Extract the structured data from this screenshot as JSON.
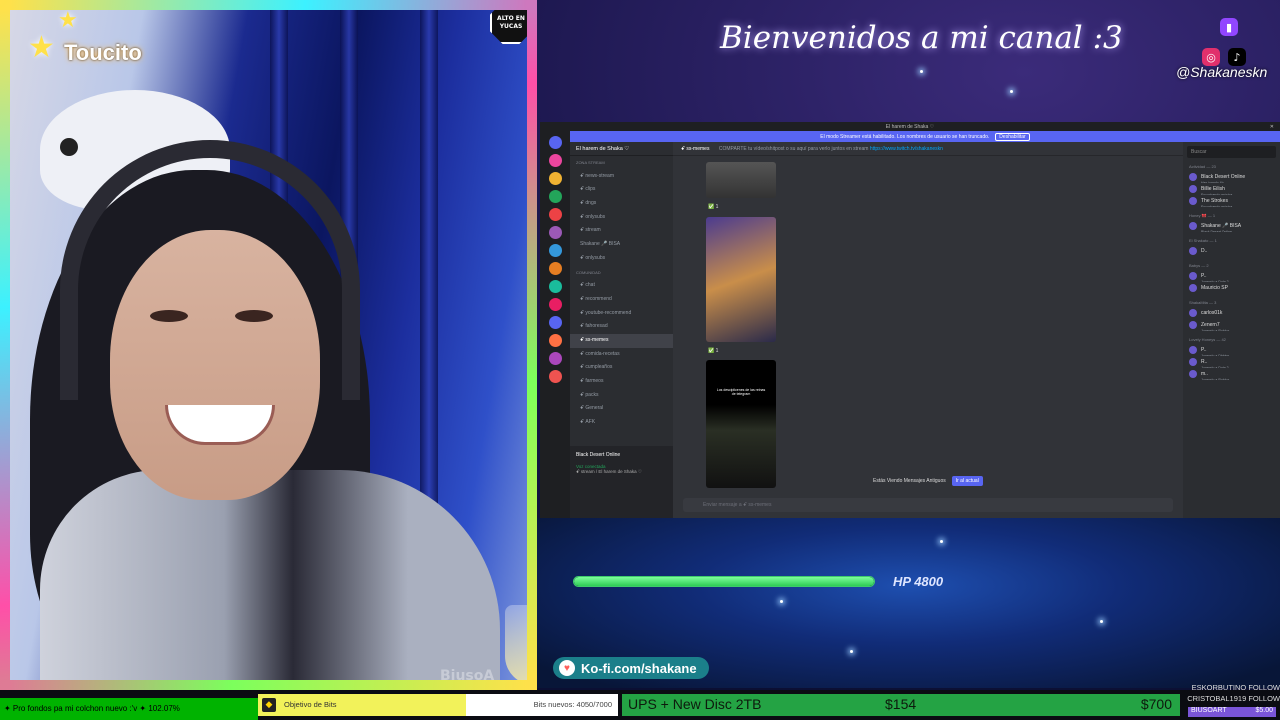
{
  "overlay": {
    "welcome_title": "Bienvenidos a mi canal :3",
    "social_handle": "@Shakaneskn",
    "social_icons": [
      "twitch-icon",
      "instagram-icon",
      "tiktok-icon"
    ],
    "webcam_sticker": "Toucito",
    "stop_sign": "ALTO EN YUCAS",
    "watermark": "BiusoA"
  },
  "discord": {
    "window_title": "El harem de Shaka ♡",
    "banner_text": "El modo Streamer está habilitado. Los nombres de usuario se han truncado.",
    "banner_button": "Deshabilitar",
    "server_name": "El harem de Shaka ♡",
    "channels": [
      {
        "label": "ZONA STREAM",
        "category": true
      },
      {
        "label": "ꗃ news-stream"
      },
      {
        "label": "ꗃ clips"
      },
      {
        "label": "ꗃ dngs"
      },
      {
        "label": "ꗃ onlysubs"
      },
      {
        "label": "ꗃ stream"
      },
      {
        "label": "Shakane 🎤 BISA"
      },
      {
        "label": "ꗃ onlysubs"
      },
      {
        "label": "COMUNIDAD",
        "category": true
      },
      {
        "label": "ꗃ chat"
      },
      {
        "label": "ꗃ recommend"
      },
      {
        "label": "ꗃ youtube-recommend"
      },
      {
        "label": "ꗃ fahoresad"
      },
      {
        "label": "ꗃ ss-memes",
        "active": true
      },
      {
        "label": "ꗃ comida-recetas"
      },
      {
        "label": "ꗃ cumpleaños"
      },
      {
        "label": "ꗃ farmeos"
      },
      {
        "label": "ꗃ packs"
      },
      {
        "label": "ꗃ General"
      },
      {
        "label": "ꗃ AFK"
      }
    ],
    "voice_panel": {
      "game": "Black Desert Online",
      "status": "Voz conectada",
      "location": "ꗃ stream / El harem de Shaka ♡"
    },
    "channel_header": "ꗃ ss-memes",
    "channel_topic": "COMPARTE tu vídeo/shitpost o su aquí para verlo juntos en stream",
    "channel_link": "https://www.twitch.tv/shakaneskn",
    "video_caption": "Los desciplicenes de las reinas de telegram",
    "old_messages_notice": "Estás Viendo Mensajes Antiguos",
    "jump_button": "Ir al actual",
    "input_placeholder": "Enviar mensaje a ꗃ ss-memes",
    "search_placeholder": "Buscar",
    "members": [
      {
        "section": "Actividad — 23"
      },
      {
        "name": "Black Desert Online",
        "sub": "Has jugado 4h"
      },
      {
        "name": "Billie Eilish",
        "sub": "Escuchando música"
      },
      {
        "name": "The Strokes",
        "sub": "Escuchando música"
      },
      {
        "section": "Honey 🎀 — 1"
      },
      {
        "name": "Shakane 🎤 BISA",
        "sub": "Black Desert Online"
      },
      {
        "section": "El Shakato — 1"
      },
      {
        "name": "D..",
        "sub": ""
      },
      {
        "section": "Babys — 2"
      },
      {
        "name": "P..",
        "sub": "Jugando a Dota 2"
      },
      {
        "name": "Mauricio SP",
        "sub": ""
      },
      {
        "section": "ShakaMita — 3"
      },
      {
        "name": "carlos01k",
        "sub": ""
      },
      {
        "name": "Zenern7",
        "sub": "Jugando a Roblox"
      },
      {
        "section": "Lovely Honeys — 42"
      },
      {
        "name": "P..",
        "sub": "Jugando a Dbbins"
      },
      {
        "name": "R..",
        "sub": "Jugando a Dota 2"
      },
      {
        "name": "m..",
        "sub": "Jugando a Roblox"
      }
    ]
  },
  "hp_bar": {
    "label": "HP 4800",
    "fill_fraction": 1.0
  },
  "kofi": {
    "label": "Ko-fi.com/shakane"
  },
  "bottom": {
    "ticker": "✦ Pro fondos pa mi colchon nuevo :'v ✦ 102.07%",
    "bits_title": "Objetivo de Bits",
    "bits_label": "Bits nuevos:",
    "bits_current": "4050",
    "bits_goal": "/7000",
    "bits_fraction": 0.579,
    "goal_title": "UPS + New Disc 2TB",
    "goal_current": "$154",
    "goal_target": "$700",
    "follow1": "ESKORBUTINO  FOLLOW",
    "follow2": "CRISTOBAL1919  FOLLOW",
    "recent_donor": "BIUSOART",
    "recent_amount": "$5.00"
  },
  "colors": {
    "discord_blurple": "#5865f2",
    "hp_green": "#2ecc55",
    "goal_green": "#24a344",
    "ticker_green": "#00b300"
  }
}
